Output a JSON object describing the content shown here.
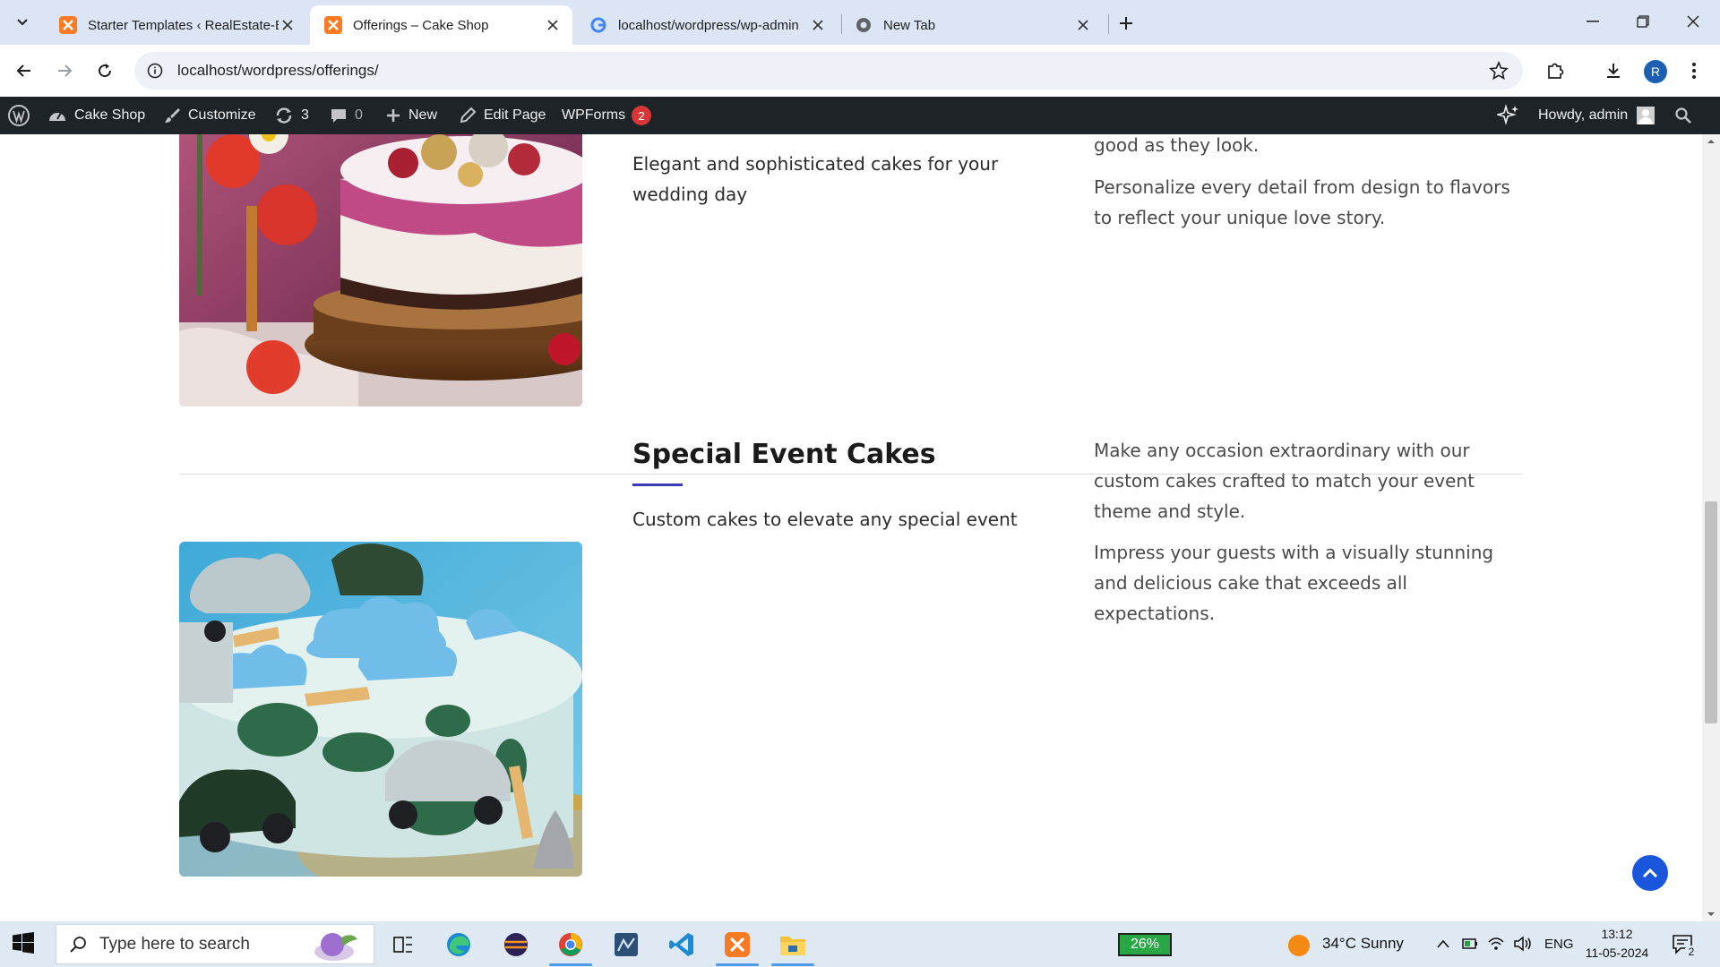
{
  "browser": {
    "tabs": [
      {
        "title": "Starter Templates ‹ RealEstate-E",
        "active": false
      },
      {
        "title": "Offerings – Cake Shop",
        "active": true
      },
      {
        "title": "localhost/wordpress/wp-admin",
        "active": false
      },
      {
        "title": "New Tab",
        "active": false
      }
    ],
    "url": "localhost/wordpress/offerings/",
    "profile_initial": "R"
  },
  "adminbar": {
    "site_name": "Cake Shop",
    "customize": "Customize",
    "updates_count": "3",
    "comments_count": "0",
    "new": "New",
    "edit_page": "Edit Page",
    "wpforms": "WPForms",
    "wpforms_badge": "2",
    "howdy": "Howdy, admin"
  },
  "sections": [
    {
      "subtitle": "Elegant and sophisticated cakes for your wedding day",
      "paragraphs": [
        "good as they look.",
        "Personalize every detail from design to flavors to reflect your unique love story."
      ]
    },
    {
      "heading": "Special Event Cakes",
      "subtitle": "Custom cakes to elevate any special event",
      "paragraphs": [
        "Make any occasion extraordinary with our custom cakes crafted to match your event theme and style.",
        "Impress your guests with a visually stunning and delicious cake that exceeds all expectations."
      ]
    }
  ],
  "taskbar": {
    "search_placeholder": "Type here to search",
    "battery": "26%",
    "weather": "34°C  Sunny",
    "language": "ENG",
    "time": "13:12",
    "date": "11-05-2024",
    "notifications": "2"
  }
}
